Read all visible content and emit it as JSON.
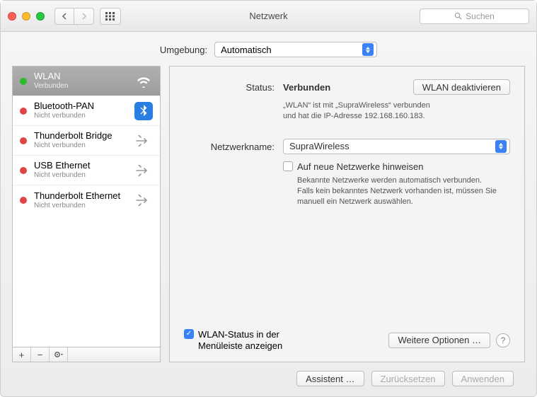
{
  "window": {
    "title": "Netzwerk",
    "search_placeholder": "Suchen"
  },
  "location": {
    "label": "Umgebung:",
    "value": "Automatisch"
  },
  "sidebar": {
    "items": [
      {
        "name": "WLAN",
        "sub": "Verbunden"
      },
      {
        "name": "Bluetooth-PAN",
        "sub": "Nicht verbunden"
      },
      {
        "name": "Thunderbolt Bridge",
        "sub": "Nicht verbunden"
      },
      {
        "name": "USB Ethernet",
        "sub": "Nicht verbunden"
      },
      {
        "name": "Thunderbolt Ethernet",
        "sub": "Nicht verbunden"
      }
    ]
  },
  "main": {
    "status_label": "Status:",
    "status_value": "Verbunden",
    "deactivate_btn": "WLAN deaktivieren",
    "status_detail1": "„WLAN“ ist mit „SupraWireless“ verbunden",
    "status_detail2": "und hat die IP-Adresse 192.168.160.183.",
    "network_label": "Netzwerkname:",
    "network_value": "SupraWireless",
    "notify_label": "Auf neue Netzwerke hinweisen",
    "notify_help1": "Bekannte Netzwerke werden automatisch verbunden.",
    "notify_help2": "Falls kein bekanntes Netzwerk vorhanden ist, müssen Sie",
    "notify_help3": "manuell ein Netzwerk auswählen.",
    "menubar_label1": "WLAN-Status in der",
    "menubar_label2": "Menüleiste anzeigen",
    "advanced_btn": "Weitere Optionen …"
  },
  "footer": {
    "assist": "Assistent …",
    "revert": "Zurücksetzen",
    "apply": "Anwenden"
  }
}
